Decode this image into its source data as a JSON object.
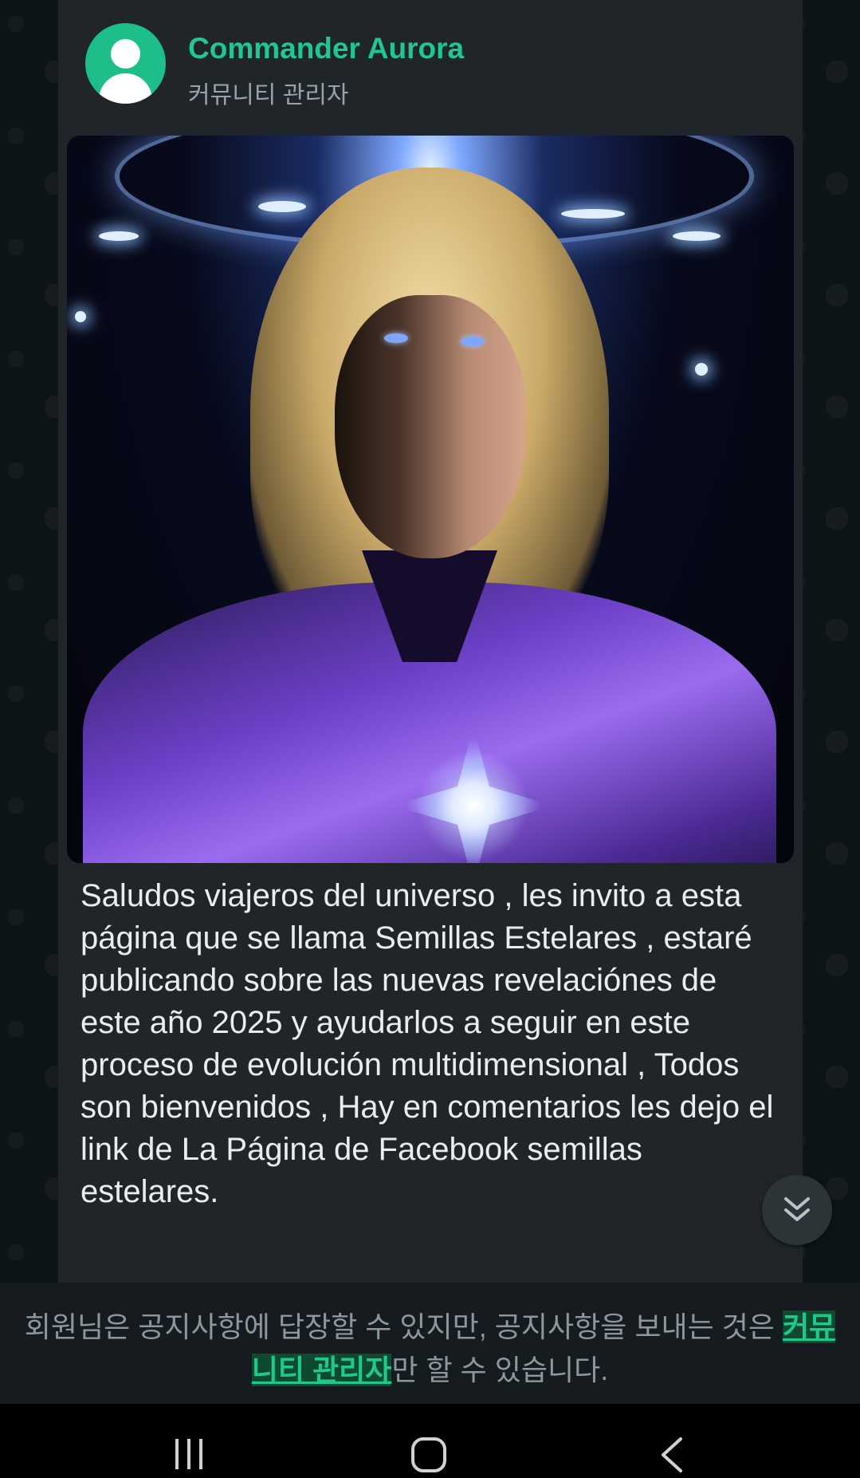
{
  "post": {
    "sender_name": "Commander Aurora",
    "sender_role": "커뮤니티 관리자",
    "message": "Saludos viajeros del universo , les invito a esta página que se llama Semillas Estelares , estaré publicando sobre las nuevas revelaciónes de este año 2025 y ayudarlos a seguir en este proceso de evolución multidimensional , Todos son bienvenidos , Hay en comentarios les dejo el link de La Página de Facebook semillas estelares."
  },
  "notice": {
    "text_before": "회원님은 공지사항에 답장할 수 있지만, 공지사항을 보내는 것은 ",
    "link_text": "커뮤니티 관리자",
    "text_after": "만 할 수 있습니다."
  },
  "icons": {
    "avatar": "default-user-avatar-icon",
    "scroll_down": "double-chevron-down-icon",
    "nav_recent": "recent-apps-icon",
    "nav_home": "home-icon",
    "nav_back": "back-icon"
  },
  "colors": {
    "accent": "#21c78f",
    "bubble": "#1f2529",
    "background": "#0d1418"
  }
}
